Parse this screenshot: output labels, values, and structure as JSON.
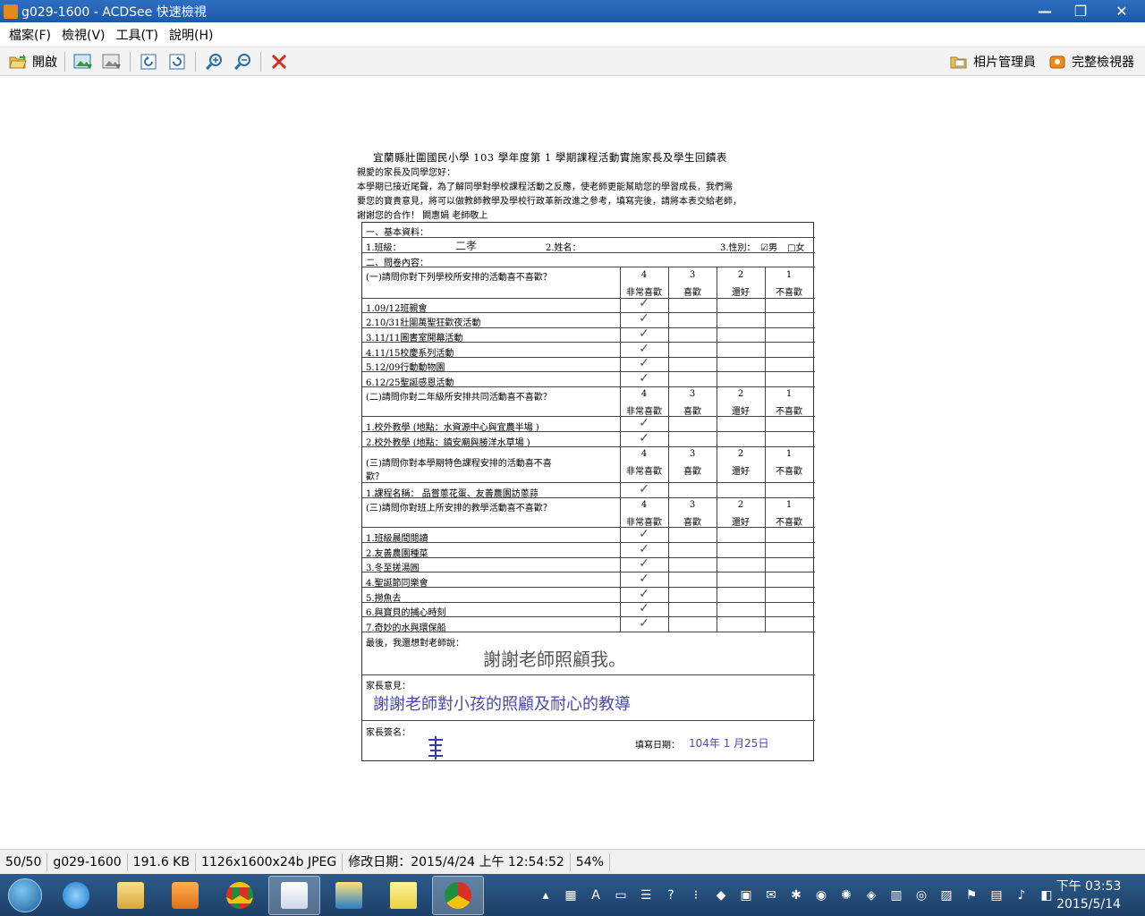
{
  "window": {
    "title": "g029-1600 - ACDSee 快速檢視",
    "buttons": {
      "minimize": "—",
      "maximize": "❐",
      "close": "✕"
    }
  },
  "menu": [
    "檔案(F)",
    "檢視(V)",
    "工具(T)",
    "說明(H)"
  ],
  "toolbar": {
    "open_label": "開啟",
    "photo_manager_label": "相片管理員",
    "full_viewer_label": "完整檢視器",
    "icons": [
      "open-folder-icon",
      "previous-image-icon",
      "next-image-icon",
      "rotate-left-icon",
      "rotate-right-icon",
      "zoom-in-icon",
      "zoom-out-icon",
      "delete-icon"
    ]
  },
  "document": {
    "title": "宜蘭縣壯圍國民小學 103 學年度第 1 學期課程活動實施家長及學生回饋表",
    "intro": [
      "親愛的家長及同學您好：",
      "本學期已接近尾聲，為了解同學對學校課程活動之反應，使老師更能幫助您的學習成長，我們需",
      "要您的寶貴意見，將可以做教師教學及學校行政革新改進之參考，填寫完後，請將本表交給老師，",
      "謝謝您的合作！  闕惠娟 老師敬上"
    ],
    "basic_info_label": "一、基本資料：",
    "class_label": "1.班級：",
    "class_value": "二孝",
    "name_label": "2.姓名：",
    "gender_label": "3.性別：",
    "gender_male": "☑男",
    "gender_female": "□女",
    "survey_label": "二、問卷內容：",
    "scale_numbers": [
      "4",
      "3",
      "2",
      "1"
    ],
    "scale_labels": [
      "非常喜歡",
      "喜歡",
      "還好",
      "不喜歡"
    ],
    "section1": {
      "question": "(一)請問你對下列學校所安排的活動喜不喜歡？",
      "items": [
        "1.09/12班親會",
        "2.10/31壯圍萬聖狂歡夜活動",
        "3.11/11圖書室開幕活動",
        "4.11/15校慶系列活動",
        "5.12/09行動動物園",
        "6.12/25聖誕感恩活動"
      ]
    },
    "section2": {
      "question": "(二)請問你對二年級所安排共同活動喜不喜歡？",
      "items": [
        "1.校外教學 (地點：水資源中心與宜農半場 )",
        "2.校外教學 (地點：鎮安廟與勝洋水草場 )"
      ]
    },
    "section3": {
      "question_line1": "(三)請問你對本學期特色課程安排的活動喜不喜",
      "question_line2": "歡？",
      "items": [
        "1.課程名稱： 品嘗蔥花蛋、友善農園訪蔥蒜"
      ]
    },
    "section4": {
      "question": "(三)請問你對班上所安排的教學活動喜不喜歡？",
      "items": [
        "1.班級晨間閱讀",
        "2.友善農園種菜",
        "3.冬至搓湯圓",
        "4.聖誕節同樂會",
        "5.撈魚去",
        "6.與寶貝的捕心時刻",
        "7.奇妙的水與環保船"
      ]
    },
    "comment_label": "最後，我還想對老師說：",
    "comment_handwritten": "謝謝老師照顧我。",
    "parent_opinion_label": "家長意見：",
    "parent_opinion_handwritten": "謝謝老師對小孩的照顧及耐心的教導",
    "parent_signature_label": "家長簽名：",
    "fill_date_label": "填寫日期：",
    "fill_date_value": "104年 1 月25日"
  },
  "statusbar": {
    "index": "50/50",
    "filename": "g029-1600",
    "filesize": "191.6 KB",
    "dimensions": "1126x1600x24b JPEG",
    "modified": "修改日期：2015/4/24 上午 12:54:52",
    "zoom": "54%"
  },
  "taskbar": {
    "apps": [
      "internet-explorer-icon",
      "file-explorer-icon",
      "media-player-icon",
      "chrome-icon",
      "acdsee-icon",
      "paint-icon",
      "sticky-notes-icon",
      "chrome-profile-icon"
    ],
    "clock_time": "下午 03:53",
    "clock_date": "2015/5/14"
  }
}
